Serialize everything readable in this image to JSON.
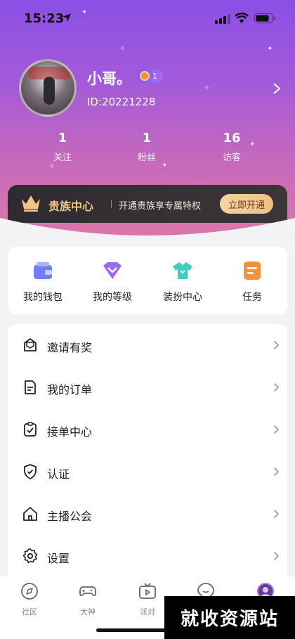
{
  "status_bar": {
    "time": "15:23"
  },
  "profile": {
    "username": "小哥。",
    "level_badge": "1",
    "id_text": "ID:20221228",
    "stats": [
      {
        "value": "1",
        "label": "关注"
      },
      {
        "value": "1",
        "label": "粉丝"
      },
      {
        "value": "16",
        "label": "访客"
      }
    ]
  },
  "noble": {
    "title": "贵族中心",
    "description": "开通贵族享专属特权",
    "button": "立即开通"
  },
  "grid": [
    {
      "label": "我的钱包",
      "icon": "wallet-icon"
    },
    {
      "label": "我的等级",
      "icon": "level-icon"
    },
    {
      "label": "装扮中心",
      "icon": "tshirt-icon"
    },
    {
      "label": "任务",
      "icon": "task-icon"
    }
  ],
  "menu": [
    {
      "label": "邀请有奖",
      "icon": "invite-icon"
    },
    {
      "label": "我的订单",
      "icon": "order-icon"
    },
    {
      "label": "接单中心",
      "icon": "accept-order-icon"
    },
    {
      "label": "认证",
      "icon": "shield-icon"
    },
    {
      "label": "主播公会",
      "icon": "home-icon"
    },
    {
      "label": "设置",
      "icon": "gear-icon"
    }
  ],
  "tabs": [
    {
      "label": "社区",
      "icon": "compass-icon"
    },
    {
      "label": "大神",
      "icon": "gamepad-icon"
    },
    {
      "label": "派对",
      "icon": "tv-icon"
    },
    {
      "label": "",
      "icon": "message-icon"
    },
    {
      "label": "",
      "icon": "avatar-icon"
    }
  ],
  "watermark": "就收资源站",
  "colors": {
    "accent_purple": "#8b4fe6",
    "noble_gold": "#f3c58a"
  }
}
